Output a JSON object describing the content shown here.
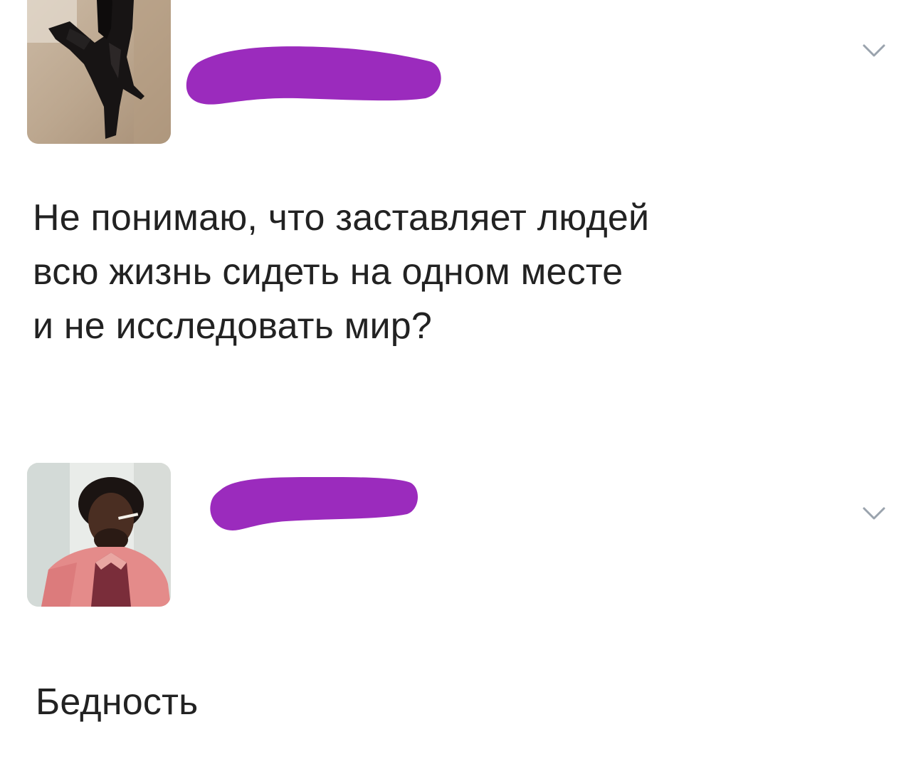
{
  "posts": [
    {
      "avatar_icon": "user-avatar-boot-photo",
      "name_redaction_color": "#9b2bbd",
      "menu_icon": "chevron-down-icon",
      "text_lines": [
        "Не понимаю, что заставляет людей",
        "всю жизнь сидеть на одном месте",
        "и не исследовать мир?"
      ]
    },
    {
      "avatar_icon": "user-avatar-man-photo",
      "name_redaction_color": "#9b2bbd",
      "menu_icon": "chevron-down-icon",
      "text_lines": [
        "Бедность"
      ]
    }
  ],
  "colors": {
    "text": "#222222",
    "chevron": "#9aa3ad",
    "redaction": "#9b2bbd"
  }
}
